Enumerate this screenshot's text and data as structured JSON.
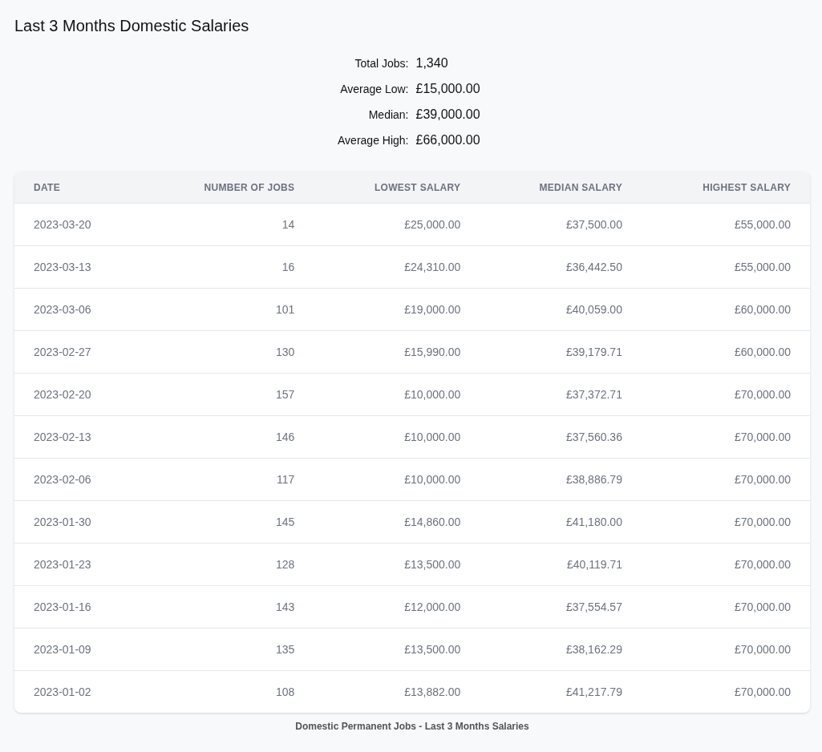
{
  "title": "Last 3 Months Domestic Salaries",
  "summary": [
    {
      "label": "Total Jobs:",
      "value": "1,340"
    },
    {
      "label": "Average Low:",
      "value": "£15,000.00"
    },
    {
      "label": "Median:",
      "value": "£39,000.00"
    },
    {
      "label": "Average High:",
      "value": "£66,000.00"
    }
  ],
  "table": {
    "columns": [
      "DATE",
      "NUMBER OF JOBS",
      "LOWEST SALARY",
      "MEDIAN SALARY",
      "HIGHEST SALARY"
    ],
    "rows": [
      [
        "2023-03-20",
        "14",
        "£25,000.00",
        "£37,500.00",
        "£55,000.00"
      ],
      [
        "2023-03-13",
        "16",
        "£24,310.00",
        "£36,442.50",
        "£55,000.00"
      ],
      [
        "2023-03-06",
        "101",
        "£19,000.00",
        "£40,059.00",
        "£60,000.00"
      ],
      [
        "2023-02-27",
        "130",
        "£15,990.00",
        "£39,179.71",
        "£60,000.00"
      ],
      [
        "2023-02-20",
        "157",
        "£10,000.00",
        "£37,372.71",
        "£70,000.00"
      ],
      [
        "2023-02-13",
        "146",
        "£10,000.00",
        "£37,560.36",
        "£70,000.00"
      ],
      [
        "2023-02-06",
        "117",
        "£10,000.00",
        "£38,886.79",
        "£70,000.00"
      ],
      [
        "2023-01-30",
        "145",
        "£14,860.00",
        "£41,180.00",
        "£70,000.00"
      ],
      [
        "2023-01-23",
        "128",
        "£13,500.00",
        "£40,119.71",
        "£70,000.00"
      ],
      [
        "2023-01-16",
        "143",
        "£12,000.00",
        "£37,554.57",
        "£70,000.00"
      ],
      [
        "2023-01-09",
        "135",
        "£13,500.00",
        "£38,162.29",
        "£70,000.00"
      ],
      [
        "2023-01-02",
        "108",
        "£13,882.00",
        "£41,217.79",
        "£70,000.00"
      ]
    ]
  },
  "caption": "Domestic Permanent Jobs - Last 3 Months Salaries"
}
